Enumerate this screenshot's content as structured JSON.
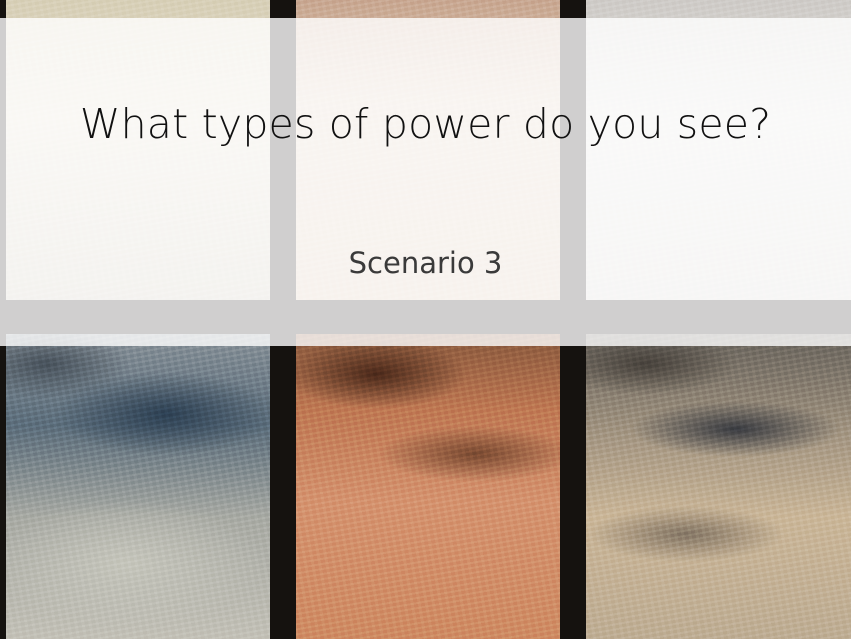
{
  "slide": {
    "title": "What types of power do you see?",
    "subtitle": "Scenario 3",
    "colors": {
      "overlay": "#ffffff",
      "title_text": "#111111",
      "subtitle_text": "#3a3a3a",
      "frame": "#15120f"
    },
    "background_image": "stained-glass-window-panes"
  }
}
